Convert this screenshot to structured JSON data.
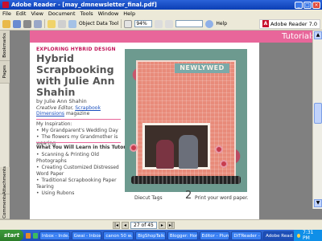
{
  "window": {
    "title": "Adobe Reader - [may_dmnewsletter_final.pdf]"
  },
  "menu": [
    "File",
    "Edit",
    "View",
    "Document",
    "Tools",
    "Window",
    "Help"
  ],
  "toolbar": {
    "object_data_tool": "Object Data Tool",
    "zoom": "94%",
    "help": "Help",
    "brand": "Adobe Reader 7.0"
  },
  "nav_tabs": {
    "bookmarks": "Bookmarks",
    "pages": "Pages",
    "attachments": "Attachments",
    "comments": "Comments"
  },
  "page": {
    "section": "Tutorials",
    "kicker": "EXPLORING HYBRID DESIGN",
    "headline": "Hybrid Scrapbooking with Julie Ann Shahin",
    "byline": "by Julie Ann Shahin",
    "editor_prefix": "Creative Editor,",
    "editor_link": "Scrapbook Dimensions",
    "editor_suffix": "magazine",
    "inspiration_heading": "My Inspiration:",
    "inspiration": [
      "My Grandparent's Wedding Day",
      "The flowers my Grandmother is wearing"
    ],
    "learn_heading": "What You Will Learn in this Tutorial:",
    "learn": [
      "Scanning & Printing Old Photographs",
      "Creating Customized Distressed Word Paper",
      "Traditional Scrapbooking Paper Tearing",
      "Using Rubons"
    ],
    "photo_title": "NEWLYWED",
    "caption_left": "Diecut Tags",
    "step_number": "2",
    "caption_right": "Print your word paper."
  },
  "status": {
    "page_display": "27 of 45"
  },
  "taskbar": {
    "start": "start",
    "tasks": [
      "Inbox - Inde...",
      "Gwai - Inbox...",
      "canon 50 w...",
      "BigShopTalk...",
      "Blogger: Hor...",
      "Editor - Plum...",
      "DiTReader - ...",
      "Adobe Read..."
    ],
    "active_index": 7,
    "clock": "7:31 PM"
  },
  "colors": {
    "accent": "#e8669a",
    "kicker": "#c2185b",
    "link": "#1a4fbf"
  }
}
